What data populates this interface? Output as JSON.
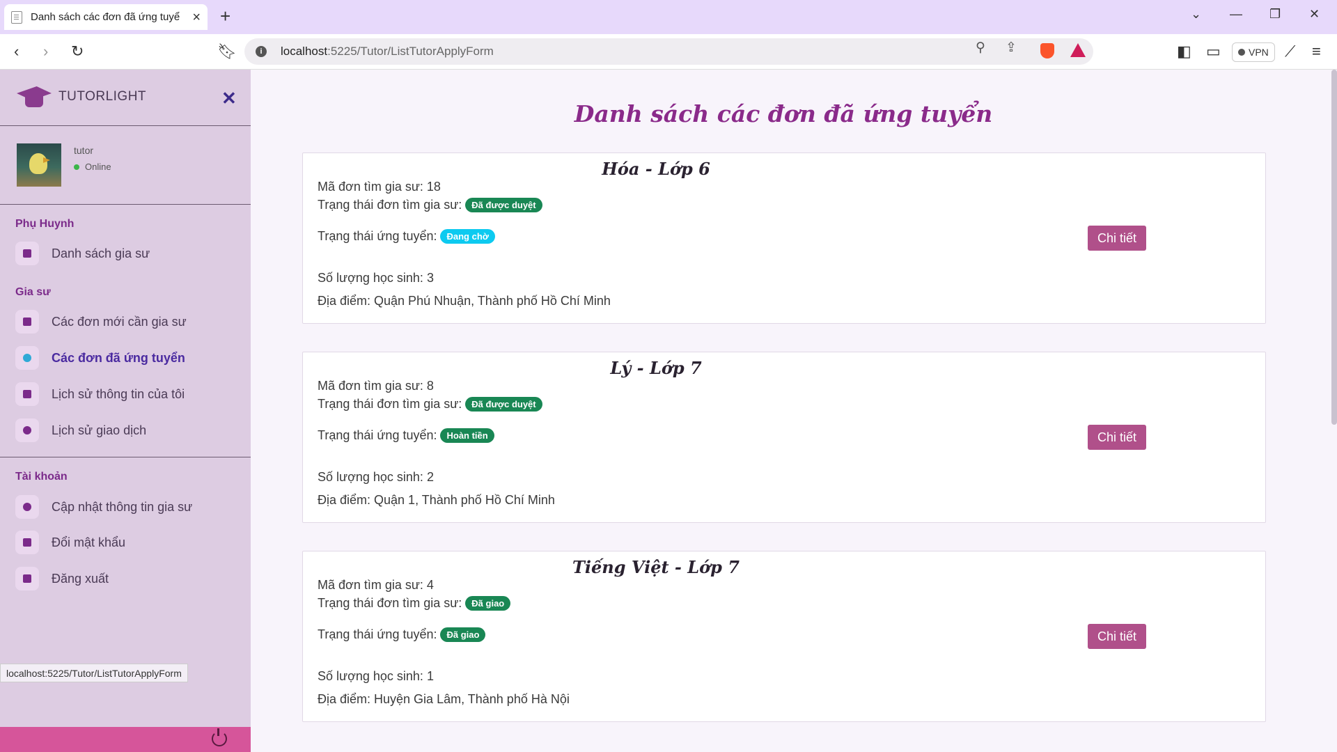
{
  "browser": {
    "tab_title": "Danh sách các đơn đã ứng tuyể",
    "url_host": "localhost",
    "url_path": ":5225/Tutor/ListTutorApplyForm",
    "vpn_label": "VPN",
    "status_url": "localhost:5225/Tutor/ListTutorApplyForm"
  },
  "sidebar": {
    "brand": "TUTORLIGHT",
    "user": {
      "name": "tutor",
      "status": "Online"
    },
    "sections": [
      {
        "title": "Phụ Huynh",
        "items": [
          {
            "label": "Danh sách gia sư",
            "icon": "id-card-icon"
          }
        ]
      },
      {
        "title": "Gia sư",
        "items": [
          {
            "label": "Các đơn mới cần gia sư",
            "icon": "calendar-icon"
          },
          {
            "label": "Các đơn đã ứng tuyển",
            "icon": "check-circle-icon",
            "active": true
          },
          {
            "label": "Lịch sử thông tin của tôi",
            "icon": "inbox-icon"
          },
          {
            "label": "Lịch sử giao dịch",
            "icon": "history-icon"
          }
        ]
      },
      {
        "title": "Tài khoản",
        "items": [
          {
            "label": "Cập nhật thông tin gia sư",
            "icon": "info-icon"
          },
          {
            "label": "Đổi mật khẩu",
            "icon": "unlock-icon"
          },
          {
            "label": "Đăng xuất",
            "icon": "logout-icon"
          }
        ]
      }
    ]
  },
  "main": {
    "page_title": "Danh sách các đơn đã ứng tuyển",
    "cards": [
      {
        "title": "Hóa - Lớp 6",
        "id_label": "Mã đơn tìm gia sư: 18",
        "form_status_label": "Trạng thái đơn tìm gia sư:",
        "form_status": "Đã được duyệt",
        "form_status_color": "#198754",
        "apply_status_label": "Trạng thái ứng tuyển:",
        "apply_status": "Đang chờ",
        "apply_status_color": "#0dcaf0",
        "students": "Số lượng học sinh: 3",
        "location": "Địa điểm: Quận Phú Nhuận, Thành phố Hồ Chí Minh",
        "button": "Chi tiết"
      },
      {
        "title": "Lý - Lớp 7",
        "id_label": "Mã đơn tìm gia sư: 8",
        "form_status_label": "Trạng thái đơn tìm gia sư:",
        "form_status": "Đã được duyệt",
        "form_status_color": "#198754",
        "apply_status_label": "Trạng thái ứng tuyển:",
        "apply_status": "Hoàn tiền",
        "apply_status_color": "#198754",
        "students": "Số lượng học sinh: 2",
        "location": "Địa điểm: Quận 1, Thành phố Hồ Chí Minh",
        "button": "Chi tiết"
      },
      {
        "title": "Tiếng Việt - Lớp 7",
        "id_label": "Mã đơn tìm gia sư: 4",
        "form_status_label": "Trạng thái đơn tìm gia sư:",
        "form_status": "Đã giao",
        "form_status_color": "#198754",
        "apply_status_label": "Trạng thái ứng tuyển:",
        "apply_status": "Đã giao",
        "apply_status_color": "#198754",
        "students": "Số lượng học sinh: 1",
        "location": "Địa điểm: Huyện Gia Lâm, Thành phố Hà Nội",
        "button": "Chi tiết"
      }
    ]
  }
}
